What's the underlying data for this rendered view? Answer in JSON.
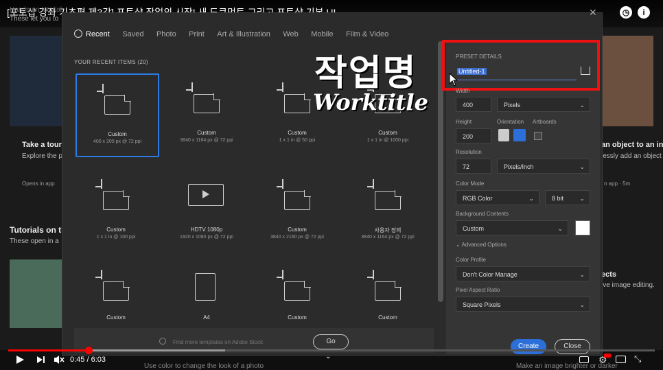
{
  "video": {
    "title": "[포토샵 강좌 기초편 제3강] 포토샵 작업의 시작! 새 도큐먼트 그리고 포토샵 기본 UI",
    "time_current": "0:45",
    "time_sep": "/",
    "time_total": "6:03",
    "progress_fraction": 0.124
  },
  "background": {
    "partial_heading_top": "Hands-on tutorial",
    "partial_sub_top": "These let you to",
    "card_left_title": "Take a tour",
    "card_left_sub": "Explore the po",
    "card_left_meta": "Opens in app",
    "card_right_title": "an object to an in",
    "card_right_sub": "lessly add an object",
    "card_right_meta": "n app · 5m",
    "section_title": "Tutorials on th",
    "section_sub": "These open in a",
    "right_partial_1": "ects",
    "right_partial_2": "ive image editing.",
    "bottom_left": "Use color to change the look of a photo",
    "bottom_right": "Make an image brighter or darker"
  },
  "dialog": {
    "tabs": [
      "Recent",
      "Saved",
      "Photo",
      "Print",
      "Art & Illustration",
      "Web",
      "Mobile",
      "Film & Video"
    ],
    "recent_heading": "YOUR RECENT ITEMS  (20)",
    "items": [
      {
        "name": "Custom",
        "size": "400 x 200 px @ 72 ppi"
      },
      {
        "name": "Custom",
        "size": "3840 x 1164 px @ 72 ppi"
      },
      {
        "name": "Custom",
        "size": "1 x 1 in @ 50 ppi"
      },
      {
        "name": "Custom",
        "size": "1 x 1 in @ 1000 ppi"
      },
      {
        "name": "Custom",
        "size": "1 x 1 in @ 100 ppi"
      },
      {
        "name": "HDTV 1080p",
        "size": "1920 x 1080 px @ 72 ppi"
      },
      {
        "name": "Custom",
        "size": "3840 x 2160 px @ 72 ppi"
      },
      {
        "name": "사용자 정의",
        "size": "3840 x 1164 px @ 72 ppi"
      },
      {
        "name": "Custom",
        "size": ""
      },
      {
        "name": "A4",
        "size": ""
      },
      {
        "name": "Custom",
        "size": ""
      },
      {
        "name": "Custom",
        "size": ""
      }
    ],
    "search_placeholder": "Find more templates on Adobe Stock",
    "go_label": "Go"
  },
  "preset": {
    "heading": "PRESET DETAILS",
    "name": "Untitled-1",
    "width_label": "Width",
    "width_value": "400",
    "width_unit": "Pixels",
    "height_label": "Height",
    "height_value": "200",
    "orientation_label": "Orientation",
    "artboards_label": "Artboards",
    "resolution_label": "Resolution",
    "resolution_value": "72",
    "resolution_unit": "Pixels/Inch",
    "color_mode_label": "Color Mode",
    "color_mode_value": "RGB Color",
    "bit_depth": "8 bit",
    "bg_label": "Background Contents",
    "bg_value": "Custom",
    "advanced_label": "Advanced Options",
    "color_profile_label": "Color Profile",
    "color_profile_value": "Don't Color Manage",
    "pixel_aspect_label": "Pixel Aspect Ratio",
    "pixel_aspect_value": "Square Pixels",
    "create_label": "Create",
    "close_label": "Close"
  },
  "overlay": {
    "korean": "작업명",
    "english": "Worktitle"
  },
  "colors": {
    "accent_blue": "#2d6fd8",
    "highlight_red": "#e11111",
    "progress_red": "#ff0000"
  }
}
